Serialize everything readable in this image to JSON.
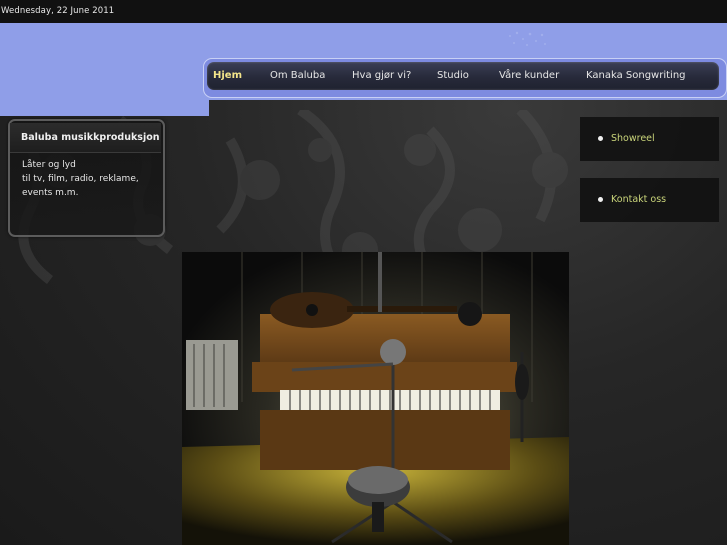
{
  "top_bar": {
    "date": "Wednesday, 22 June 2011"
  },
  "nav": {
    "items": [
      {
        "label": "Hjem",
        "active": true
      },
      {
        "label": "Om Baluba",
        "active": false
      },
      {
        "label": "Hva gjør vi?",
        "active": false
      },
      {
        "label": "Studio",
        "active": false
      },
      {
        "label": "Våre kunder",
        "active": false
      },
      {
        "label": "Kanaka Songwriting",
        "active": false
      }
    ]
  },
  "info_box": {
    "title": "Baluba musikkproduksjon",
    "lines": [
      "Låter og lyd",
      "til tv, film, radio, reklame,",
      "events m.m."
    ]
  },
  "side_links": [
    "Showreel",
    "Kontakt oss"
  ],
  "colors": {
    "header_blue": "#8f9ee8",
    "nav_active": "#f3e48a",
    "side_link": "#c9d47a",
    "background": "#262626"
  },
  "photo": {
    "icon": "studio-photo"
  }
}
